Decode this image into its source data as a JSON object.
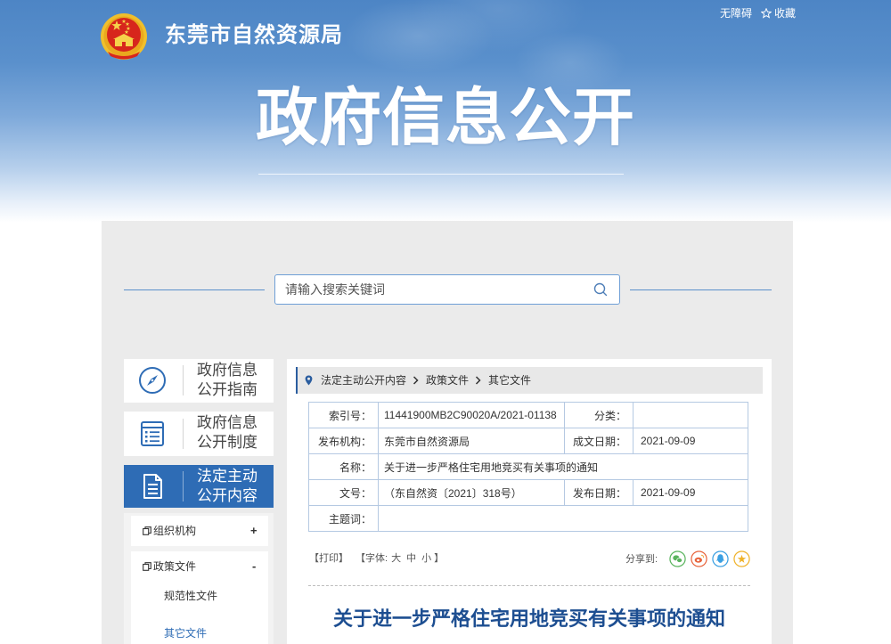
{
  "header": {
    "site_name": "东莞市自然资源局",
    "accessibility": "无障碍",
    "favorite": "收藏",
    "favorite_icon": "star-outline-icon",
    "emblem_icon": "national-emblem-icon",
    "banner_title": "政府信息公开"
  },
  "search": {
    "placeholder": "请输入搜索关键词",
    "icon": "search-icon"
  },
  "sidebar": {
    "items": [
      {
        "line1": "政府信息",
        "line2": "公开指南",
        "icon": "compass-icon",
        "active": false
      },
      {
        "line1": "政府信息",
        "line2": "公开制度",
        "icon": "list-icon",
        "active": false
      },
      {
        "line1": "法定主动",
        "line2": "公开内容",
        "icon": "document-icon",
        "active": true
      }
    ],
    "submenu": [
      {
        "label": "组织机构",
        "toggle": "+",
        "icon": "copy-icon"
      },
      {
        "label": "政策文件",
        "toggle": "-",
        "icon": "copy-icon",
        "children": [
          {
            "label": "规范性文件",
            "active": false
          },
          {
            "label": "其它文件",
            "active": true
          }
        ]
      }
    ]
  },
  "breadcrumb": [
    "法定主动公开内容",
    "政策文件",
    "其它文件"
  ],
  "meta": {
    "index_no": {
      "label": "索引号：",
      "value": "11441900MB2C90020A/2021-01138"
    },
    "category": {
      "label": "分类："
    },
    "publisher": {
      "label": "发布机构：",
      "value": "东莞市自然资源局"
    },
    "written_date": {
      "label": "成文日期：",
      "value": "2021-09-09"
    },
    "name": {
      "label": "名称：",
      "value": "关于进一步严格住宅用地竞买有关事项的通知"
    },
    "doc_no": {
      "label": "文号：",
      "value": "（东自然资〔2021〕318号）"
    },
    "publish_date": {
      "label": "发布日期：",
      "value": "2021-09-09"
    },
    "keywords": {
      "label": "主题词："
    }
  },
  "tools": {
    "print": "【打印】",
    "font_prefix": "【字体:",
    "font_large": "大",
    "font_medium": "中",
    "font_small": "小",
    "font_suffix": "】",
    "share_label": "分享到:",
    "share_icons": [
      "wechat-icon",
      "weibo-icon",
      "qq-icon",
      "qzone-icon"
    ]
  },
  "article": {
    "title": "关于进一步严格住宅用地竞买有关事项的通知"
  },
  "colors": {
    "primary": "#2e6cb5",
    "title": "#1d4e91",
    "border": "#b5c9e2"
  }
}
